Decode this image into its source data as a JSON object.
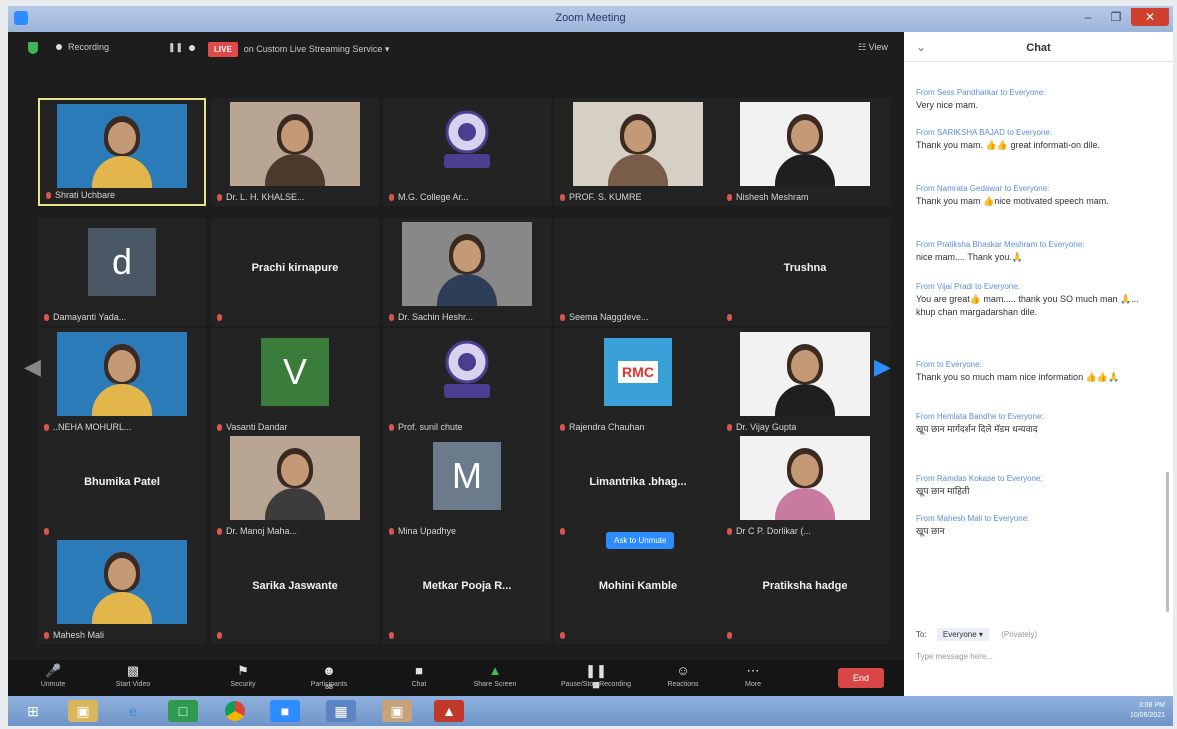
{
  "window": {
    "title": "Zoom Meeting"
  },
  "topbar": {
    "recording": "Recording",
    "live": "LIVE",
    "live_service": "on Custom Live Streaming Service ▾",
    "view": "☷ View"
  },
  "tiles": [
    {
      "name": "Shrati Uchbare",
      "kind": "photo"
    },
    {
      "name": "Dr. L. H. KHALSE...",
      "kind": "photo"
    },
    {
      "name": "M.G. College Ar...",
      "kind": "logo"
    },
    {
      "name": "PROF. S. KUMRE",
      "kind": "photo"
    },
    {
      "name": "Nishesh Meshram",
      "kind": "photo"
    },
    {
      "name": "Damayanti Yada...",
      "kind": "letter",
      "letter": "d"
    },
    {
      "name": "",
      "kind": "text",
      "label": "Prachi kirnapure"
    },
    {
      "name": "Dr. Sachin Heshr...",
      "kind": "photo"
    },
    {
      "name": "Seema Naggdeve...",
      "kind": "blank"
    },
    {
      "name": "",
      "kind": "text",
      "label": "Trushna"
    },
    {
      "name": "..NEHA MOHURL...",
      "kind": "photo"
    },
    {
      "name": "Vasanti Dandar",
      "kind": "letter",
      "letter": "V"
    },
    {
      "name": "Prof. sunil chute",
      "kind": "logo"
    },
    {
      "name": "Rajendra Chauhan",
      "kind": "rmc",
      "logo_text": "RMC"
    },
    {
      "name": "Dr. Vijay Gupta",
      "kind": "photo"
    },
    {
      "name": "",
      "kind": "text",
      "label": "Bhumika Patel"
    },
    {
      "name": "Dr. Manoj Maha...",
      "kind": "photo"
    },
    {
      "name": "Mina Upadhye",
      "kind": "letter",
      "letter": "M"
    },
    {
      "name": "",
      "kind": "text",
      "label": "Limantrika .bhag..."
    },
    {
      "name": "Dr C P. Dorlikar (...",
      "kind": "photo"
    },
    {
      "name": "Mahesh Mali",
      "kind": "photo"
    },
    {
      "name": "",
      "kind": "text",
      "label": "Sarika Jaswante"
    },
    {
      "name": "",
      "kind": "text",
      "label": "Metkar  Pooja R..."
    },
    {
      "name": "",
      "kind": "text",
      "label": "Mohini Kamble"
    },
    {
      "name": "",
      "kind": "text",
      "label": "Pratiksha hadge"
    }
  ],
  "ask_tooltip": "Ask to Unmute",
  "toolbar": {
    "items": [
      "Unmute",
      "Start Video",
      "Security",
      "Participants",
      "Chat",
      "Share Screen",
      "Pause/Stop Recording",
      "Reactions",
      "More"
    ],
    "participants_count": "88",
    "end": "End"
  },
  "chat": {
    "title": "Chat",
    "messages": [
      {
        "from": "From Sess Pandharkar to Everyone:",
        "text": "Very nice mam."
      },
      {
        "from": "From SARIKSHA BAJAD to Everyone:",
        "text": "Thank you mam. 👍👍 great informati·on dile."
      },
      {
        "from": "From Namrata Gedawar to Everyone:",
        "text": "Thank you mam 👍nice motivated speech mam."
      },
      {
        "from": "From Pratiksha Bhaskar Meshram to Everyone:",
        "text": "nice mam.... Thank you.🙏"
      },
      {
        "from": "From Vijai Pradi to Everyone:",
        "text": "You are great👍 mam..... thank you SO much man 🙏... khup chan margadarshan dile."
      },
      {
        "from": "From  to Everyone:",
        "text": "Thank you so much mam nice information 👍👍🙏"
      },
      {
        "from": "From Hemlata Bandhe to Everyone:",
        "text": "खूप छान मार्गदर्शन दिले मॅडम धन्यवाद"
      },
      {
        "from": "From Ramdas Kokase to Everyone:",
        "text": "खूप छान माहिती"
      },
      {
        "from": "From Mahesh Mali to Everyone:",
        "text": "खूप छान"
      }
    ],
    "to_label": "To:",
    "to_value": "Everyone ▾",
    "private": "(Privately)",
    "input_placeholder": "Type message here..."
  },
  "taskbar": {
    "time": "3:08 PM",
    "date": "10/06/2021"
  }
}
